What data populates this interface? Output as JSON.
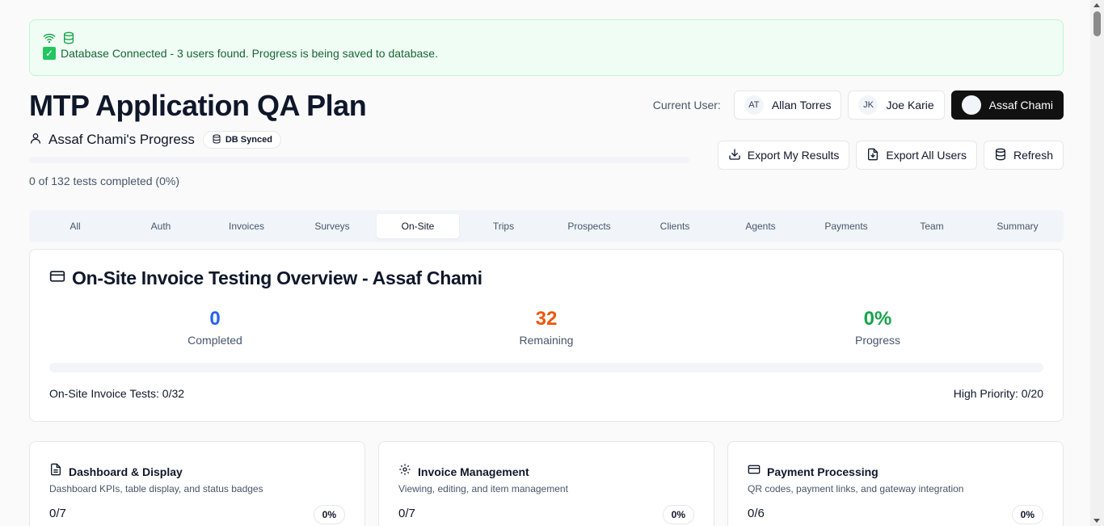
{
  "banner": {
    "message": "Database Connected - 3 users found. Progress is being saved to database.",
    "check_glyph": "✓",
    "icons": [
      "wifi-icon",
      "database-icon"
    ],
    "accent": "#166534"
  },
  "header": {
    "title": "MTP Application QA Plan",
    "current_user_label": "Current User:",
    "users": [
      {
        "initials": "AT",
        "name": "Allan Torres",
        "active": false
      },
      {
        "initials": "JK",
        "name": "Joe Karie",
        "active": false
      },
      {
        "initials": "",
        "name": "Assaf Chami",
        "active": true
      }
    ]
  },
  "progress": {
    "title": "Assaf Chami's Progress",
    "badge": "DB Synced",
    "caption": "0 of 132 tests completed (0%)",
    "fraction": 0
  },
  "actions": {
    "export_mine": "Export My Results",
    "export_all": "Export All Users",
    "refresh": "Refresh"
  },
  "tabs": {
    "items": [
      "All",
      "Auth",
      "Invoices",
      "Surveys",
      "On-Site",
      "Trips",
      "Prospects",
      "Clients",
      "Agents",
      "Payments",
      "Team",
      "Summary"
    ],
    "active": "On-Site"
  },
  "overview": {
    "title": "On-Site Invoice Testing Overview - Assaf Chami",
    "stats": [
      {
        "value": "0",
        "label": "Completed",
        "color": "#2563eb"
      },
      {
        "value": "32",
        "label": "Remaining",
        "color": "#ea580c"
      },
      {
        "value": "0%",
        "label": "Progress",
        "color": "#16a34a"
      }
    ],
    "fraction": 0,
    "footer_left": "On-Site Invoice Tests: 0/32",
    "footer_right": "High Priority: 0/20"
  },
  "cards": [
    {
      "icon": "file-text-icon",
      "title": "Dashboard & Display",
      "desc": "Dashboard KPIs, table display, and status badges",
      "count": "0/7",
      "pct": "0%"
    },
    {
      "icon": "gear-icon",
      "title": "Invoice Management",
      "desc": "Viewing, editing, and item management",
      "count": "0/7",
      "pct": "0%"
    },
    {
      "icon": "credit-card-icon",
      "title": "Payment Processing",
      "desc": "QR codes, payment links, and gateway integration",
      "count": "0/6",
      "pct": "0%"
    }
  ]
}
